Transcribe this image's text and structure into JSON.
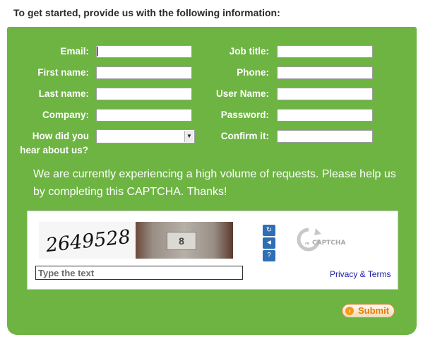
{
  "intro": "To get started, provide us with the following information:",
  "form": {
    "left": [
      {
        "label": "Email:",
        "value": ""
      },
      {
        "label": "First name:",
        "value": ""
      },
      {
        "label": "Last name:",
        "value": ""
      },
      {
        "label": "Company:",
        "value": ""
      }
    ],
    "hear_label_1": "How did you",
    "hear_label_2": "hear about us?",
    "hear_selected": "",
    "right": [
      {
        "label": "Job title:",
        "value": ""
      },
      {
        "label": "Phone:",
        "value": ""
      },
      {
        "label": "User Name:",
        "value": ""
      },
      {
        "label": "Password:",
        "value": ""
      },
      {
        "label": "Confirm it:",
        "value": ""
      }
    ]
  },
  "note": "We are currently experiencing a high volume of requests. Please help us by completing this CAPTCHA. Thanks!",
  "captcha": {
    "word": "2649528",
    "plate_number": "8",
    "placeholder": "Type the text",
    "privacy": "Privacy & Terms",
    "logo_text": "CAPTCHA",
    "logo_prefix": "re"
  },
  "submit_label": "Submit",
  "colors": {
    "panel": "#6db443",
    "link": "#1a1aa6",
    "submit": "#e47c0b"
  }
}
